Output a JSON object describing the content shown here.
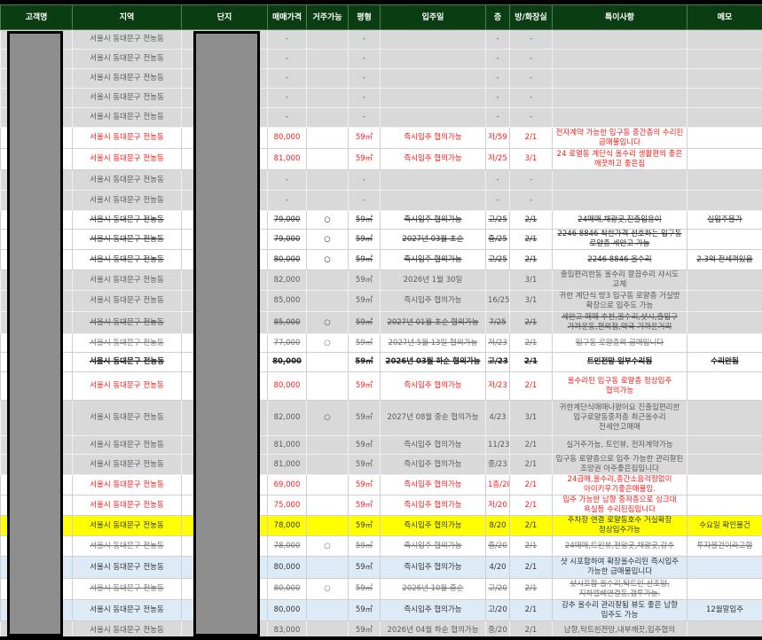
{
  "headers": [
    "고객명",
    "지역",
    "단지",
    "매매가격",
    "거주가능",
    "평형",
    "입주일",
    "층",
    "방/화장실",
    "특이사항",
    "메모"
  ],
  "colors": {
    "header_bg": "#0b3d13",
    "gray_row": "#d9d9d9",
    "red_text": "#ff1a1a",
    "yellow_row": "#ffff00",
    "blue_row": "#ddebf7"
  },
  "rows": [
    {
      "style": "gray",
      "region": "서울시 동대문구 전농동",
      "price": "-",
      "live": "",
      "size": "-",
      "movein": "",
      "floor": "-",
      "rooms": "-",
      "notes": "",
      "memo": ""
    },
    {
      "style": "gray",
      "region": "서울시 동대문구 전농동",
      "price": "-",
      "live": "",
      "size": "-",
      "movein": "",
      "floor": "-",
      "rooms": "-",
      "notes": "",
      "memo": ""
    },
    {
      "style": "gray",
      "region": "서울시 동대문구 전농동",
      "price": "-",
      "live": "",
      "size": "-",
      "movein": "",
      "floor": "-",
      "rooms": "-",
      "notes": "",
      "memo": ""
    },
    {
      "style": "gray",
      "region": "서울시 동대문구 전농동",
      "price": "-",
      "live": "",
      "size": "-",
      "movein": "",
      "floor": "-",
      "rooms": "-",
      "notes": "",
      "memo": ""
    },
    {
      "style": "gray",
      "region": "서울시 동대문구 전농동",
      "price": "-",
      "live": "",
      "size": "-",
      "movein": "",
      "floor": "-",
      "rooms": "-",
      "notes": "",
      "memo": ""
    },
    {
      "style": "red",
      "region": "서울시 동대문구 전농동",
      "price": "80,000",
      "live": "",
      "size": "59㎡",
      "movein": "즉시입주 협의가능",
      "floor": "저/59",
      "rooms": "2/1",
      "notes": "전자계약 가능한 입구동 중간층의 수리된 급매물입니다",
      "memo": ""
    },
    {
      "style": "red",
      "region": "서울시 동대문구 전농동",
      "price": "81,000",
      "live": "",
      "size": "59㎡",
      "movein": "즉시입주 협의가능",
      "floor": "저/25",
      "rooms": "3/1",
      "notes": "24 로열동 계단식 올수리 생활편의 좋은 깨끗하고 좋은집",
      "memo": ""
    },
    {
      "style": "gray",
      "region": "서울시 동대문구 전농동",
      "price": "-",
      "live": "",
      "size": "-",
      "movein": "",
      "floor": "-",
      "rooms": "-",
      "notes": "",
      "memo": ""
    },
    {
      "style": "gray",
      "region": "서울시 동대문구 전농동",
      "price": "-",
      "live": "",
      "size": "-",
      "movein": "",
      "floor": "-",
      "rooms": "-",
      "notes": "",
      "memo": ""
    },
    {
      "style": "strike-dark",
      "region": "서울시 동대문구 전농동",
      "price": "79,000",
      "live": "○",
      "size": "59㎡",
      "movein": "즉시입주 협의가능",
      "floor": "고/25",
      "rooms": "2/1",
      "notes": "24매매,채광굿,진출입용이",
      "memo": "실입주불가"
    },
    {
      "style": "strike-dark",
      "region": "서울시 동대문구 전농동",
      "price": "79,000",
      "live": "○",
      "size": "59㎡",
      "movein": "2027년 03월 초순",
      "floor": "중/25",
      "rooms": "2/1",
      "notes": "2246 8846 착한가격 선호하는 입구동 로얄층 세안고 가능",
      "memo": ""
    },
    {
      "style": "strike-dark",
      "region": "서울시 동대문구 전농동",
      "price": "80,000",
      "live": "○",
      "size": "59㎡",
      "movein": "즉시입주 협의가능",
      "floor": "고/25",
      "rooms": "2/1",
      "notes": "2246 8846 올수리",
      "memo": "2.3억 전세껴있음"
    },
    {
      "style": "gray",
      "region": "서울시 동대문구 전농동",
      "price": "82,000",
      "live": "",
      "size": "59㎡",
      "movein": "2026년 1월 30일",
      "floor": "",
      "rooms": "3/1",
      "notes": "출입편리한동 올수리 깔끔수리 샤시도 교체",
      "memo": ""
    },
    {
      "style": "gray",
      "region": "서울시 동대문구 전농동",
      "price": "85,000",
      "live": "",
      "size": "59㎡",
      "movein": "즉시입주 협의가능",
      "floor": "16/25",
      "rooms": "3/1",
      "notes": "귀한 계단식 방3 입구동 로얄층 거실방 확장으로 입주도 가능",
      "memo": ""
    },
    {
      "style": "strike-gray",
      "region": "서울시 동대문구 전농동",
      "price": "85,000",
      "live": "○",
      "size": "59㎡",
      "movein": "2027년 01월 초순 협의가능",
      "floor": "7/25",
      "rooms": "2/1",
      "notes": "세안고 매매 추천,올수리,샷시,출입구 가까운동,편의점,약국 가까운거리",
      "memo": ""
    },
    {
      "style": "strike-light",
      "region": "서울시 동대문구 전농동",
      "price": "77,000",
      "live": "○",
      "size": "59㎡",
      "movein": "2027년 5월 13일 협의가능",
      "floor": "저/23",
      "rooms": "2/1",
      "notes": "입구동 로얄층의 급매입니다",
      "memo": ""
    },
    {
      "style": "strike-bold",
      "region": "서울시 동대문구 전농동",
      "price": "80,000",
      "live": "",
      "size": "59㎡",
      "movein": "2026년 03월 하순 협의가능",
      "floor": "고/23",
      "rooms": "2/1",
      "notes": "트인전망 일부수리됨",
      "memo": "수리안됨"
    },
    {
      "style": "red",
      "region": "서울시 동대문구 전농동",
      "price": "80,000",
      "live": "",
      "size": "59㎡",
      "movein": "즉시입주 협의가능",
      "floor": "저/23",
      "rooms": "2/1",
      "notes": "올수리된 입구동 로얄층 정상입주 협의가능",
      "memo": ""
    },
    {
      "style": "gray",
      "region": "서울시 동대문구 전농동",
      "price": "82,000",
      "live": "○",
      "size": "59㎡",
      "movein": "2027년 08월 중순 협의가능",
      "floor": "4/23",
      "rooms": "3/1",
      "notes": "귀한계단식매매나왔어요 진출입편리한 입구로얄동중저층 최근올수리 전세안고매매",
      "memo": ""
    },
    {
      "style": "gray",
      "region": "서울시 동대문구 전농동",
      "price": "81,000",
      "live": "",
      "size": "59㎡",
      "movein": "즉시입주 협의가능",
      "floor": "11/23",
      "rooms": "2/1",
      "notes": "실거주가능, 트인뷰, 전자계약가능",
      "memo": ""
    },
    {
      "style": "gray",
      "region": "서울시 동대문구 전농동",
      "price": "81,000",
      "live": "",
      "size": "59㎡",
      "movein": "즉시입주 협의가능",
      "floor": "중/23",
      "rooms": "2/1",
      "notes": "입구동 로얄층으로 입주 가능한 관리잘된 조망권 아주좋은집입니다",
      "memo": ""
    },
    {
      "style": "red",
      "region": "서울시 동대문구 전농동",
      "price": "69,000",
      "live": "",
      "size": "59㎡",
      "movein": "즉시입주 협의가능",
      "floor": "1층/20",
      "rooms": "2/1",
      "notes": "24급매,올수리,층간소음걱정없이 아이키우기좋은매물임.",
      "memo": ""
    },
    {
      "style": "red",
      "region": "서울시 동대문구 전농동",
      "price": "75,000",
      "live": "",
      "size": "59㎡",
      "movein": "즉시입주 협의가능",
      "floor": "저/20",
      "rooms": "2/1",
      "notes": "입주 가능한 남향 중저층으로 싱크대 욕실등 수리된집입니다",
      "memo": ""
    },
    {
      "style": "yellow",
      "region": "서울시 동대문구 전농동",
      "price": "78,000",
      "live": "",
      "size": "59㎡",
      "movein": "즉시입주 협의가능",
      "floor": "8/20",
      "rooms": "2/1",
      "notes": "주차장 연결 로얄동호수 거실확장 정상입주가능",
      "memo": "수요일 확인물건"
    },
    {
      "style": "strike-light",
      "region": "서울시 동대문구 전농동",
      "price": "78,000",
      "live": "○",
      "size": "59㎡",
      "movein": "즉시입주 협의가능",
      "floor": "중/20",
      "rooms": "2/1",
      "notes": "24매매,트인뷰,전망굿,채광굿,강추",
      "memo": "투자물건이라고함"
    },
    {
      "style": "blue",
      "region": "서울시 동대문구 전농동",
      "price": "80,000",
      "live": "",
      "size": "59㎡",
      "movein": "즉시입주 협의가능",
      "floor": "4/20",
      "rooms": "2/1",
      "notes": "샷 시포함하여 확장올수리된 즉시입주 가능한 급매물입니다",
      "memo": ""
    },
    {
      "style": "strike-light",
      "region": "서울시 동대문구 전농동",
      "price": "80,000",
      "live": "○",
      "size": "59㎡",
      "movein": "2026년 10월 중순",
      "floor": "고/20",
      "rooms": "2/1",
      "notes": "샷시포함 올수리,탁트인 산조망,지하엘베연결동,갭투가능.",
      "memo": ""
    },
    {
      "style": "blue",
      "region": "서울시 동대문구 전농동",
      "price": "80,000",
      "live": "",
      "size": "59㎡",
      "movein": "즉시입주 협의가능",
      "floor": "고/20",
      "rooms": "2/1",
      "notes": "강추 올수리 관리잘됨 뷰도 좋은 남향 입주도 가능",
      "memo": "12월말입주"
    },
    {
      "style": "gray",
      "region": "서울시 동대문구 전농동",
      "price": "83,000",
      "live": "",
      "size": "59㎡",
      "movein": "2026년 04월 하순 협의가능",
      "floor": "중/20",
      "rooms": "2/1",
      "notes": "남향,탁트힌전망,내부깨끗,입주협의",
      "memo": ""
    }
  ]
}
